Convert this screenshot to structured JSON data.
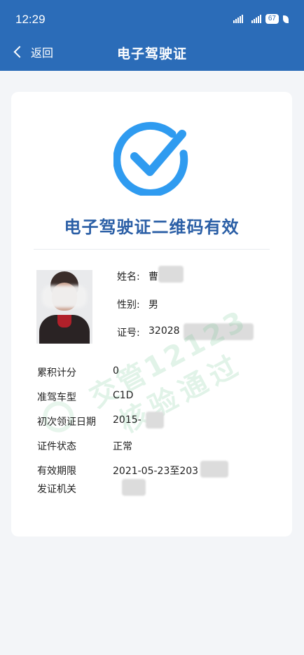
{
  "status_bar": {
    "time": "12:29",
    "battery": "67"
  },
  "nav": {
    "back_label": "返回",
    "title": "电子驾驶证"
  },
  "card": {
    "heading": "电子驾驶证二维码有效",
    "check_color": "#2f9bf0",
    "personal": [
      {
        "label": "姓名:",
        "value": "曹"
      },
      {
        "label": "性别:",
        "value": "男"
      },
      {
        "label": "证号:",
        "value": "32028"
      }
    ],
    "details": [
      {
        "label": "累积计分",
        "value": "0"
      },
      {
        "label": "准驾车型",
        "value": "C1D"
      },
      {
        "label": "初次领证日期",
        "value": "2015-"
      },
      {
        "label": "证件状态",
        "value": "正常"
      },
      {
        "label": "有效期限",
        "value": "2021-05-23至203"
      },
      {
        "label": "发证机关",
        "value": ""
      }
    ],
    "watermark": {
      "line1": "交管12123",
      "line2": "核验通过"
    }
  },
  "colors": {
    "header_bg": "#2b6cb8",
    "heading_text": "#2b5fa6",
    "page_bg": "#f3f5f8"
  }
}
